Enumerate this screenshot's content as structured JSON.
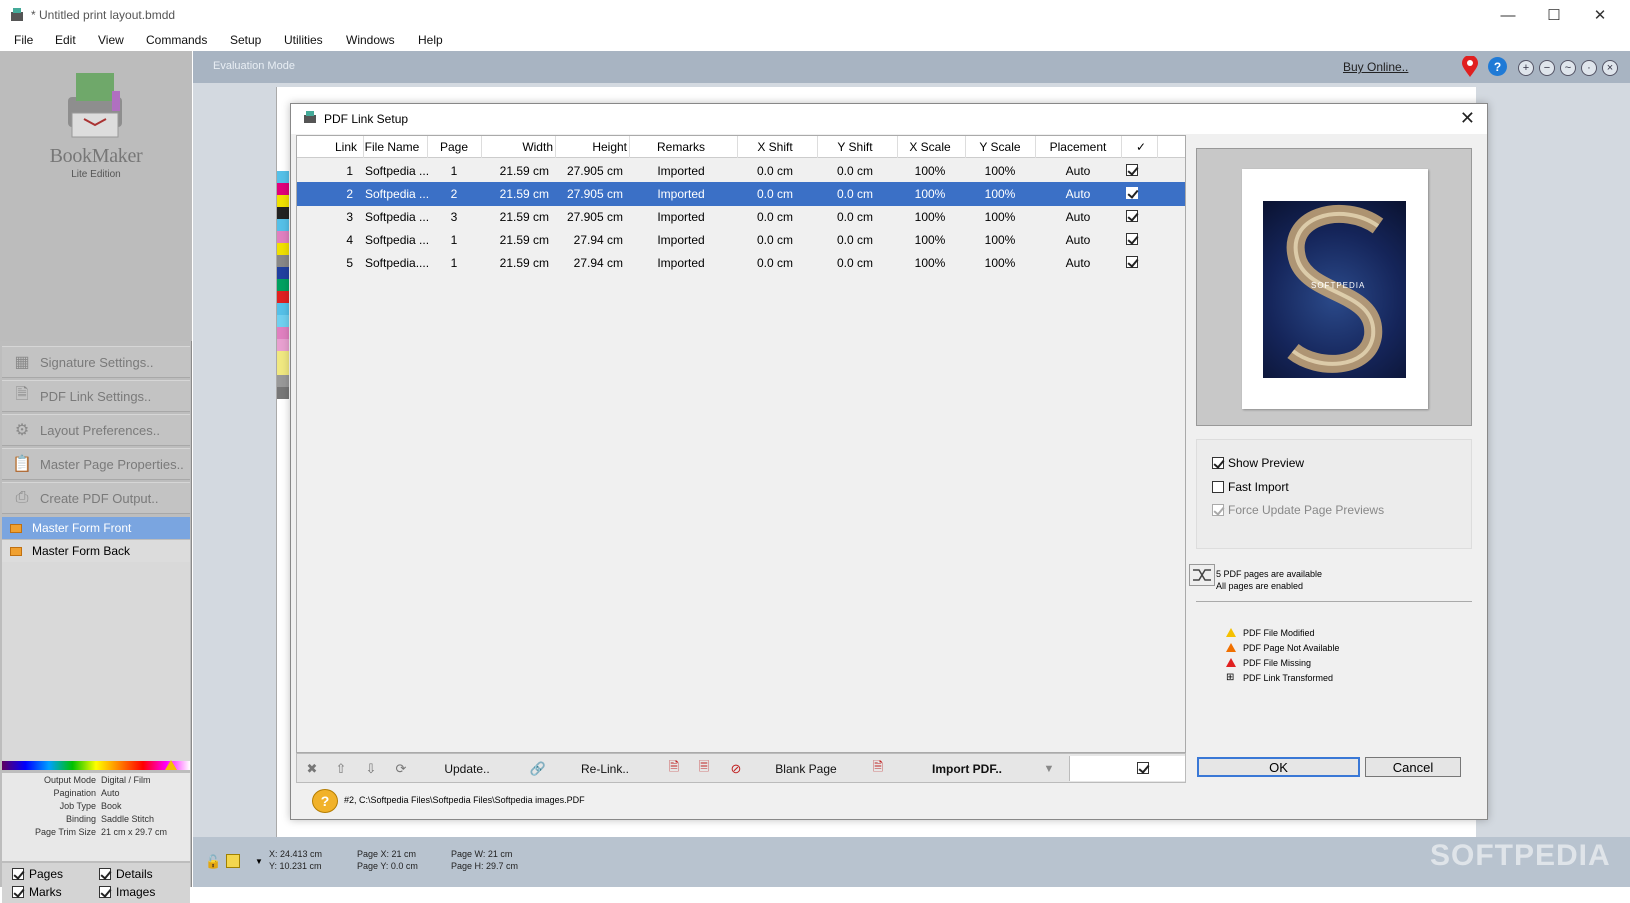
{
  "window": {
    "title": "* Untitled print layout.bmdd"
  },
  "menu": [
    "File",
    "Edit",
    "View",
    "Commands",
    "Setup",
    "Utilities",
    "Windows",
    "Help"
  ],
  "sidebar": {
    "logo": "BookMaker",
    "edition": "Lite Edition",
    "buttons": [
      "Signature Settings..",
      "PDF Link Settings..",
      "Layout Preferences..",
      "Master Page Properties..",
      "Create PDF Output.."
    ],
    "forms": [
      "Master Form Front",
      "Master Form Back"
    ],
    "info": [
      {
        "k": "Output Mode",
        "v": "Digital / Film"
      },
      {
        "k": "Pagination",
        "v": "Auto"
      },
      {
        "k": "Job Type",
        "v": "Book"
      },
      {
        "k": "Binding",
        "v": "Saddle Stitch"
      },
      {
        "k": "Page Trim Size",
        "v": "21 cm x 29.7 cm"
      }
    ],
    "checks": {
      "pages": "Pages",
      "details": "Details",
      "marks": "Marks",
      "images": "Images"
    }
  },
  "workspace": {
    "mode": "Evaluation Mode",
    "buy": "Buy Online.."
  },
  "status": {
    "xy": "X: 24.413 cm",
    "y": "Y: 10.231 cm",
    "page_x": "Page X: 21 cm",
    "page_y": "Page Y: 0.0 cm",
    "page_w": "Page W: 21 cm",
    "page_h": "Page H: 29.7 cm"
  },
  "dialog": {
    "title": "PDF Link Setup",
    "columns": [
      "Link",
      "File Name",
      "Page",
      "Width",
      "Height",
      "Remarks",
      "X Shift",
      "Y Shift",
      "X Scale",
      "Y Scale",
      "Placement",
      "✓"
    ],
    "rows": [
      [
        "1",
        "Softpedia ...",
        "1",
        "21.59 cm",
        "27.905 cm",
        "Imported",
        "0.0 cm",
        "0.0 cm",
        "100%",
        "100%",
        "Auto"
      ],
      [
        "2",
        "Softpedia ...",
        "2",
        "21.59 cm",
        "27.905 cm",
        "Imported",
        "0.0 cm",
        "0.0 cm",
        "100%",
        "100%",
        "Auto"
      ],
      [
        "3",
        "Softpedia ...",
        "3",
        "21.59 cm",
        "27.905 cm",
        "Imported",
        "0.0 cm",
        "0.0 cm",
        "100%",
        "100%",
        "Auto"
      ],
      [
        "4",
        "Softpedia ...",
        "1",
        "21.59 cm",
        "27.94 cm",
        "Imported",
        "0.0 cm",
        "0.0 cm",
        "100%",
        "100%",
        "Auto"
      ],
      [
        "5",
        "Softpedia....",
        "1",
        "21.59 cm",
        "27.94 cm",
        "Imported",
        "0.0 cm",
        "0.0 cm",
        "100%",
        "100%",
        "Auto"
      ]
    ],
    "toolbar": {
      "update": "Update..",
      "relink": "Re-Link..",
      "blank": "Blank Page",
      "import": "Import PDF.."
    },
    "path": "#2, C:\\Softpedia Files\\Softpedia Files\\Softpedia images.PDF",
    "options": {
      "show_preview": "Show Preview",
      "fast_import": "Fast Import",
      "force_update": "Force Update Page Previews"
    },
    "pdfinfo": {
      "line1": "5 PDF pages are available",
      "line2": "All pages are enabled"
    },
    "legend": [
      "PDF File Modified",
      "PDF Page Not Available",
      "PDF File Missing",
      "PDF Link Transformed"
    ],
    "ok": "OK",
    "cancel": "Cancel",
    "preview_text": "SOFTPEDIA"
  },
  "watermark": "SOFTPEDIA"
}
